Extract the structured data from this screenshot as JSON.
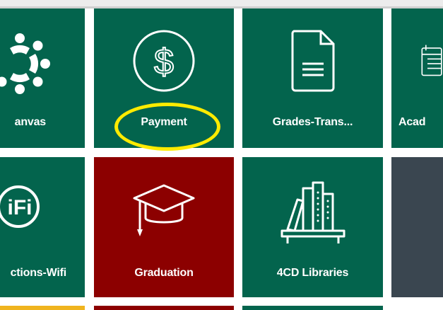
{
  "tiles": {
    "canvas": {
      "label": "anvas",
      "icon": "canvas-logo-icon",
      "color": "#03644d"
    },
    "payment": {
      "label": "Payment",
      "icon": "dollar-circle-icon",
      "color": "#03644d"
    },
    "grades": {
      "label": "Grades-Trans...",
      "icon": "document-icon",
      "color": "#03644d"
    },
    "academic": {
      "label": "Acad",
      "icon": "calendar-icon",
      "color": "#03644d"
    },
    "wifi": {
      "label": "ctions-Wifi",
      "icon": "wifi-icon",
      "color": "#03644d"
    },
    "graduation": {
      "label": "Graduation",
      "icon": "graduation-cap-icon",
      "color": "#8c0000"
    },
    "libraries": {
      "label": "4CD Libraries",
      "icon": "library-books-icon",
      "color": "#03644d"
    }
  },
  "highlight_color": "#ffeb00"
}
